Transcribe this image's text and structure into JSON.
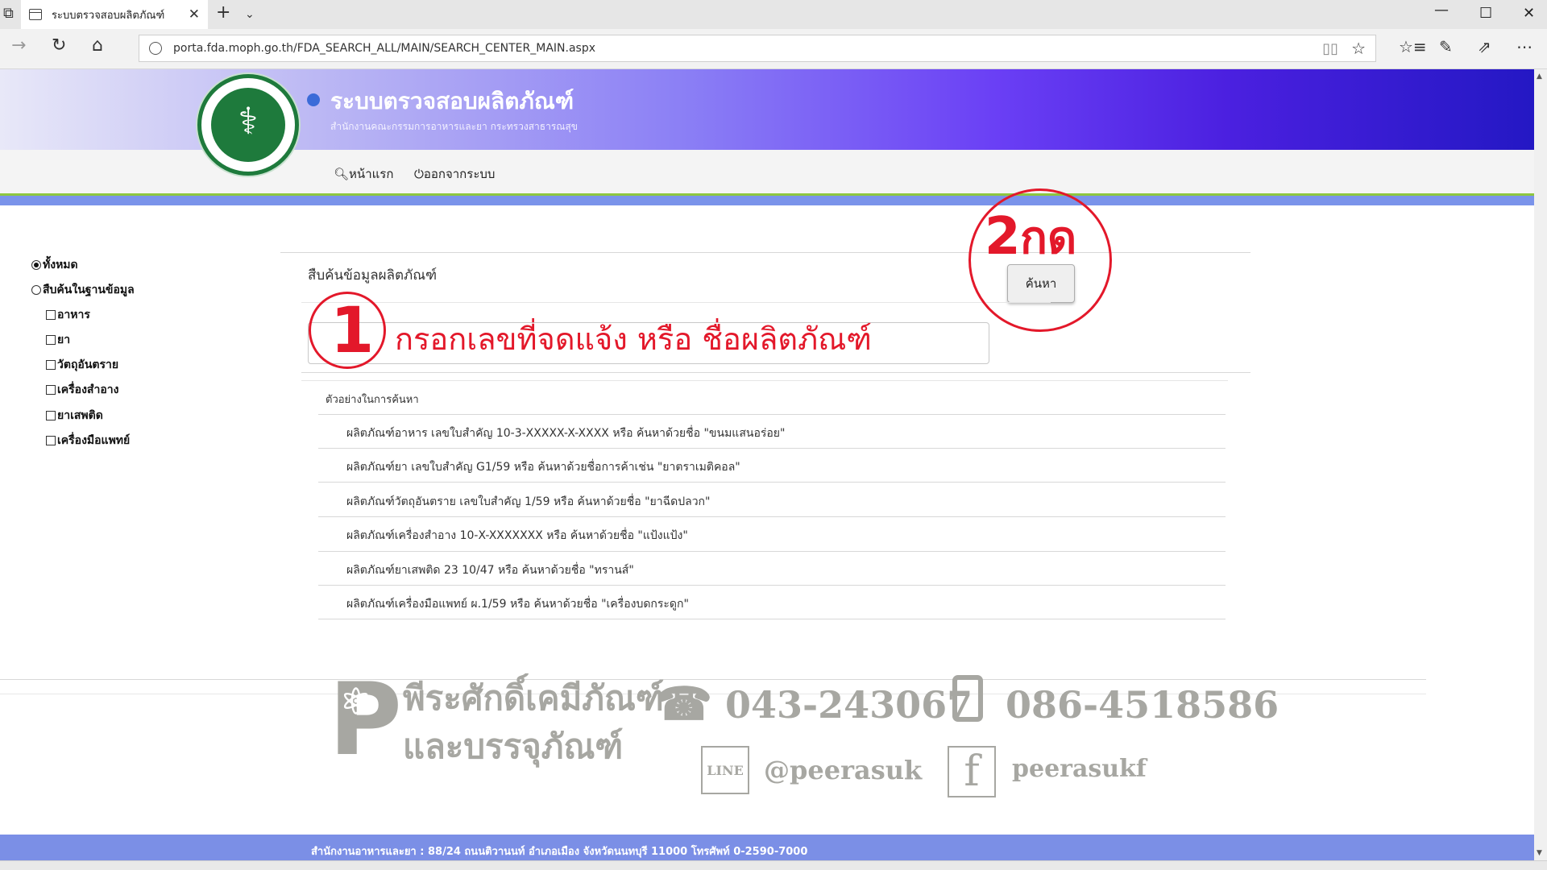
{
  "browser": {
    "tab_title": "ระบบตรวจสอบผลิตภัณฑ์",
    "url": "porta.fda.moph.go.th/FDA_SEARCH_ALL/MAIN/SEARCH_CENTER_MAIN.aspx",
    "icons": [
      "tab-page-icon",
      "close-icon",
      "plus-icon",
      "chevron-down-icon",
      "minimize-icon",
      "maximize-icon",
      "close-window-icon",
      "back-icon",
      "refresh-icon",
      "home-icon",
      "globe-icon",
      "reading-view-icon",
      "star-icon",
      "favorites-icon",
      "pen-icon",
      "share-icon",
      "more-icon"
    ]
  },
  "header": {
    "title": "ระบบตรวจสอบผลิตภัณฑ์",
    "subtitle": "สำนักงานคณะกรรมการอาหารและยา กระทรวงสาธารณสุข",
    "nav": {
      "home": "หน้าแรก",
      "logout": "ออกจากระบบ"
    }
  },
  "filters": {
    "all": "ทั้งหมด",
    "database": "สืบค้นในฐานข้อมูล",
    "items": [
      "อาหาร",
      "ยา",
      "วัตถุอันตราย",
      "เครื่องสำอาง",
      "ยาเสพติด",
      "เครื่องมือแพทย์"
    ]
  },
  "search": {
    "title": "สืบค้นข้อมูลผลิตภัณฑ์",
    "button": "ค้นหา",
    "input_value": "",
    "examples_header": "ตัวอย่างในการค้นหา",
    "examples": [
      "ผลิตภัณฑ์อาหาร เลขใบสำคัญ 10-3-XXXXX-X-XXXX หรือ ค้นหาด้วยชื่อ  \"ขนมแสนอร่อย\"",
      "ผลิตภัณฑ์ยา เลขใบสำคัญ G1/59 หรือ ค้นหาด้วยชื่อการค้าเช่น \"ยาตราเมติคอล\"",
      "ผลิตภัณฑ์วัตถุอันตราย เลขใบสำคัญ 1/59 หรือ ค้นหาด้วยชื่อ \"ยาฉีดปลวก\"",
      "ผลิตภัณฑ์เครื่องสำอาง 10-X-XXXXXXX หรือ ค้นหาด้วยชื่อ \"แป้งแป้ง\"",
      "ผลิตภัณฑ์ยาเสพติด 23 10/47 หรือ ค้นหาด้วยชื่อ \"ทรานส์\"",
      "ผลิตภัณฑ์เครื่องมือแพทย์ ผ.1/59 หรือ ค้นหาด้วยชื่อ \"เครื่องบดกระดูก\""
    ]
  },
  "annotations": {
    "step1_number": "1",
    "step1_text": "กรอกเลขที่จดแจ้ง  หรือ ชื่อผลิตภัณฑ์",
    "step2_number": "2",
    "step2_text": "กด"
  },
  "watermark": {
    "logo_letter": "P",
    "name_line1": "พีระศักดิ์เคมีภัณฑ์",
    "name_line2": "และบรรจุภัณฑ์",
    "phone1": "043-243067",
    "phone2": "086-4518586",
    "line_label": "LINE",
    "line_id": "@peerasuk",
    "fb_letter": "f",
    "fb_id": "peerasukf"
  },
  "footer": {
    "text": "สำนักงานอาหารและยา : 88/24 ถนนติวานนท์ อำเภอเมือง จังหวัดนนทบุรี 11000 โทรศัพท์ 0-2590-7000"
  },
  "colors": {
    "annotation_red": "#e3182a",
    "header_blue": "#4b20e0",
    "green_accent": "#8dc63f",
    "footer_blue": "#7b8fe6",
    "logo_green": "#1e7a3c"
  }
}
